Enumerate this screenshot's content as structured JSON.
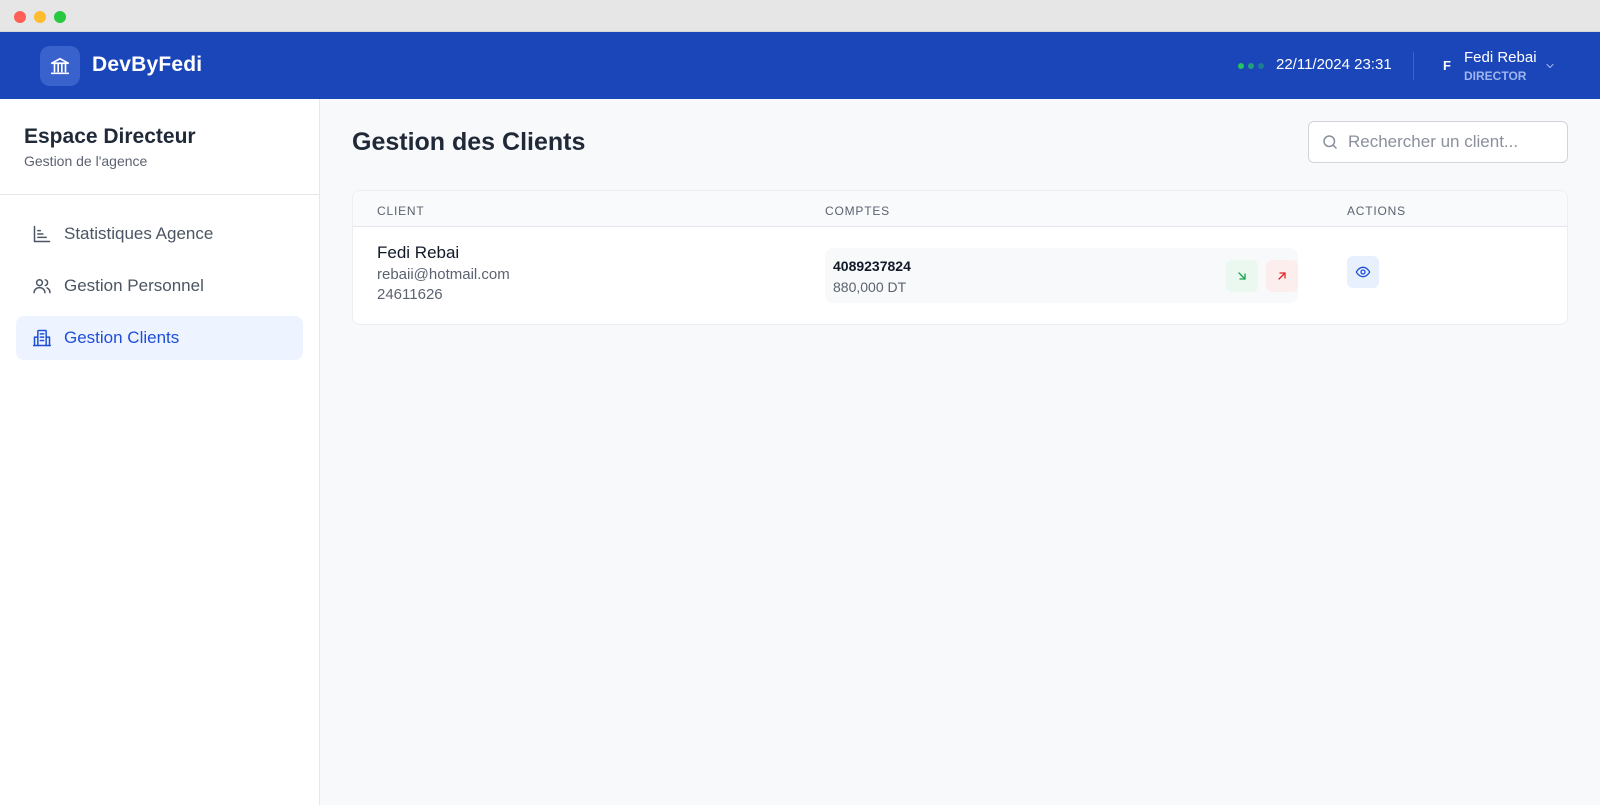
{
  "header": {
    "brand": "DevByFedi",
    "datetime": "22/11/2024 23:31",
    "status_dot_colors": [
      "#22c55e",
      "#22c55e",
      "#3b82f6"
    ],
    "user": {
      "initial": "F",
      "name": "Fedi Rebai",
      "role": "DIRECTOR"
    }
  },
  "sidebar": {
    "title": "Espace Directeur",
    "subtitle": "Gestion de l'agence",
    "items": [
      {
        "label": "Statistiques Agence",
        "icon": "bar-chart-icon",
        "active": false
      },
      {
        "label": "Gestion Personnel",
        "icon": "users-icon",
        "active": false
      },
      {
        "label": "Gestion Clients",
        "icon": "building-icon",
        "active": true
      }
    ]
  },
  "main": {
    "title": "Gestion des Clients",
    "search": {
      "placeholder": "Rechercher un client..."
    },
    "table": {
      "columns": [
        "CLIENT",
        "COMPTES",
        "ACTIONS"
      ],
      "rows": [
        {
          "name": "Fedi Rebai",
          "email": "rebaii@hotmail.com",
          "phone": "24611626",
          "accounts": [
            {
              "number": "4089237824",
              "balance": "880,000 DT"
            }
          ]
        }
      ]
    }
  },
  "colors": {
    "appbar": "#1b46b9",
    "accent": "#1d4ed8",
    "deposit": "#16a34a",
    "withdraw": "#dc2626"
  }
}
